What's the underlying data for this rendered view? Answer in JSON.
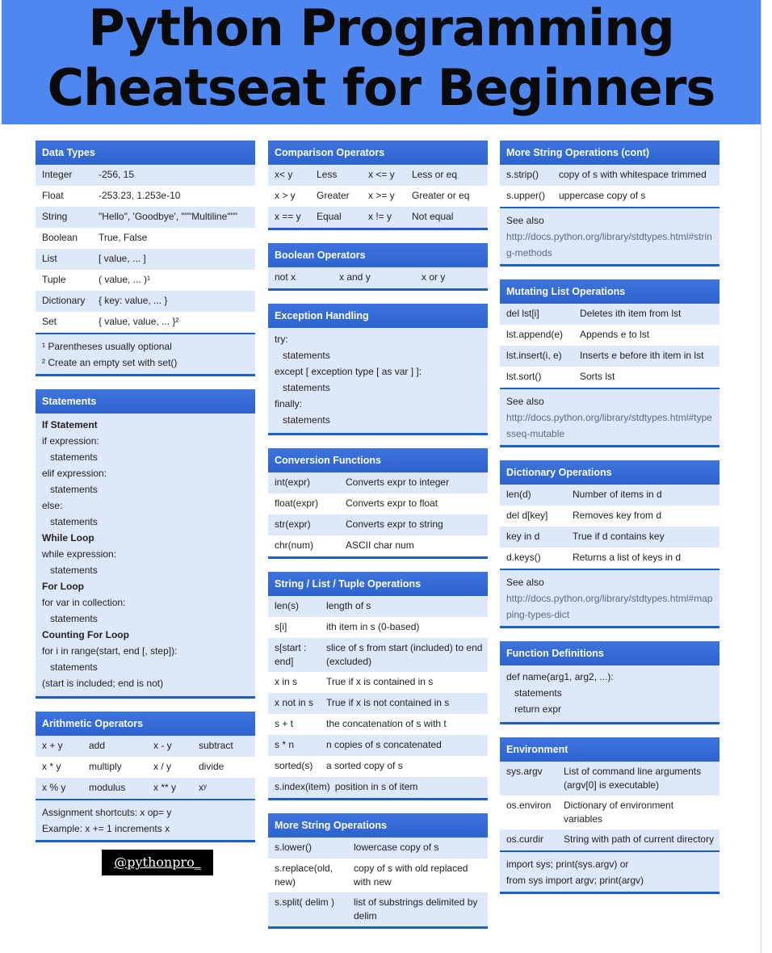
{
  "header": {
    "line1": "Python Programming",
    "line2": "Cheatseat for Beginners"
  },
  "colors": {
    "header_bg": "#4f87f0",
    "section_head": "#2c63cf",
    "alt_row": "#dde8fa"
  },
  "handle": "@pythonpro_",
  "data_types": {
    "title": "Data Types",
    "rows": [
      [
        "Integer",
        "-256, 15"
      ],
      [
        "Float",
        "-253.23, 1.253e-10"
      ],
      [
        "String",
        "\"Hello\", 'Goodbye', \"\"\"Multiline\"\"\""
      ],
      [
        "Boolean",
        "True, False"
      ],
      [
        "List",
        "[ value, ... ]"
      ],
      [
        "Tuple",
        "( value, ... )¹"
      ],
      [
        "Dictionary",
        "{ key: value, ... }"
      ],
      [
        "Set",
        "{ value, value, ... }²"
      ]
    ],
    "notes": [
      "¹ Parentheses usually optional",
      "² Create an empty set with set()"
    ]
  },
  "statements": {
    "title": "Statements",
    "lines": [
      {
        "t": "If Statement",
        "b": true
      },
      {
        "t": "if expression:"
      },
      {
        "t": "   statements"
      },
      {
        "t": "elif expression:"
      },
      {
        "t": "   statements"
      },
      {
        "t": "else:"
      },
      {
        "t": "   statements"
      },
      {
        "t": "While Loop",
        "b": true
      },
      {
        "t": "while expression:"
      },
      {
        "t": "   statements"
      },
      {
        "t": "For Loop",
        "b": true
      },
      {
        "t": "for var in collection:"
      },
      {
        "t": "   statements"
      },
      {
        "t": "Counting For Loop",
        "b": true
      },
      {
        "t": "for i in range(start, end [, step]):"
      },
      {
        "t": "   statements"
      },
      {
        "t": "(start is included; end is not)"
      }
    ]
  },
  "arithmetic": {
    "title": "Arithmetic Operators",
    "rows": [
      [
        "x + y",
        "add",
        "x - y",
        "subtract"
      ],
      [
        "x * y",
        "multiply",
        "x / y",
        "divide"
      ],
      [
        "x % y",
        "modulus",
        "x ** y",
        "xʸ"
      ]
    ],
    "notes": [
      "Assignment shortcuts: x op= y",
      "Example: x += 1 increments x"
    ]
  },
  "comparison": {
    "title": "Comparison Operators",
    "rows": [
      [
        "x< y",
        "Less",
        "x <= y",
        "Less or eq"
      ],
      [
        "x > y",
        "Greater",
        "x >= y",
        "Greater or eq"
      ],
      [
        "x == y",
        "Equal",
        "x != y",
        "Not equal"
      ]
    ]
  },
  "boolean": {
    "title": "Boolean Operators",
    "rows": [
      [
        "not x",
        "x and y",
        "x or y"
      ]
    ]
  },
  "exception": {
    "title": "Exception Handling",
    "lines": [
      "try:",
      "   statements",
      "except [ exception type [ as var ] ]:",
      "   statements",
      "finally:",
      "   statements"
    ]
  },
  "conversion": {
    "title": "Conversion Functions",
    "rows": [
      [
        "int(expr)",
        "Converts expr to integer"
      ],
      [
        "float(expr)",
        "Converts expr to float"
      ],
      [
        "str(expr)",
        "Converts expr to string"
      ],
      [
        "chr(num)",
        "ASCII char num"
      ]
    ]
  },
  "slt_ops": {
    "title": "String / List / Tuple Operations",
    "rows": [
      [
        "len(s)",
        "length of s"
      ],
      [
        "s[i]",
        "ith item in s (0-based)"
      ],
      [
        "s[start : end]",
        "slice of s from start (included) to end (excluded)"
      ],
      [
        "x in s",
        "True if x is contained in s"
      ],
      [
        "x not in s",
        "True if x is not contained in s"
      ],
      [
        "s + t",
        "the concatenation of s with t"
      ],
      [
        "s * n",
        "n copies of s concatenated"
      ],
      [
        "sorted(s)",
        "a sorted copy of s"
      ],
      [
        "s.index(item)",
        "position in s of item"
      ]
    ]
  },
  "more_string": {
    "title": "More String Operations",
    "rows": [
      [
        "s.lower()",
        "lowercase copy of s"
      ],
      [
        "s.replace(old, new)",
        "copy of s with old replaced with new"
      ],
      [
        "s.split( delim )",
        "list of substrings delimited by delim"
      ]
    ]
  },
  "more_string_cont": {
    "title": "More String Operations (cont)",
    "rows": [
      [
        "s.strip()",
        "copy of s with whitespace trimmed"
      ],
      [
        "s.upper()",
        "uppercase copy of s"
      ]
    ],
    "see": "See also",
    "link": "http://docs.python.org/library/stdtypes.html#string-methods"
  },
  "mutating": {
    "title": "Mutating List Operations",
    "rows": [
      [
        "del lst[i]",
        "Deletes ith item from lst"
      ],
      [
        "lst.append(e)",
        "Appends e to lst"
      ],
      [
        "lst.insert(i, e)",
        "Inserts e before ith item in lst"
      ],
      [
        "lst.sort()",
        "Sorts lst"
      ]
    ],
    "see": "See also",
    "link": "http://docs.python.org/library/stdtypes.html#typesseq-mutable"
  },
  "dictionary": {
    "title": "Dictionary Operations",
    "rows": [
      [
        "len(d)",
        "Number of items in d"
      ],
      [
        "del d[key]",
        "Removes key from d"
      ],
      [
        "key in d",
        "True if d contains key"
      ],
      [
        "d.keys()",
        "Returns a list of keys in d"
      ]
    ],
    "see": "See also",
    "link": "http://docs.python.org/library/stdtypes.html#mapping-types-dict"
  },
  "functions": {
    "title": "Function Definitions",
    "lines": [
      "def name(arg1, arg2, ...):",
      "   statements",
      "   return expr"
    ]
  },
  "environment": {
    "title": "Environment",
    "rows": [
      [
        "sys.argv",
        "List of command line arguments (argv[0] is executable)"
      ],
      [
        "os.environ",
        "Dictionary of environment variables"
      ],
      [
        "os.curdir",
        "String with path of current directory"
      ]
    ],
    "notes": [
      "import sys; print(sys.argv)    or",
      "from sys import argv; print(argv)"
    ]
  }
}
